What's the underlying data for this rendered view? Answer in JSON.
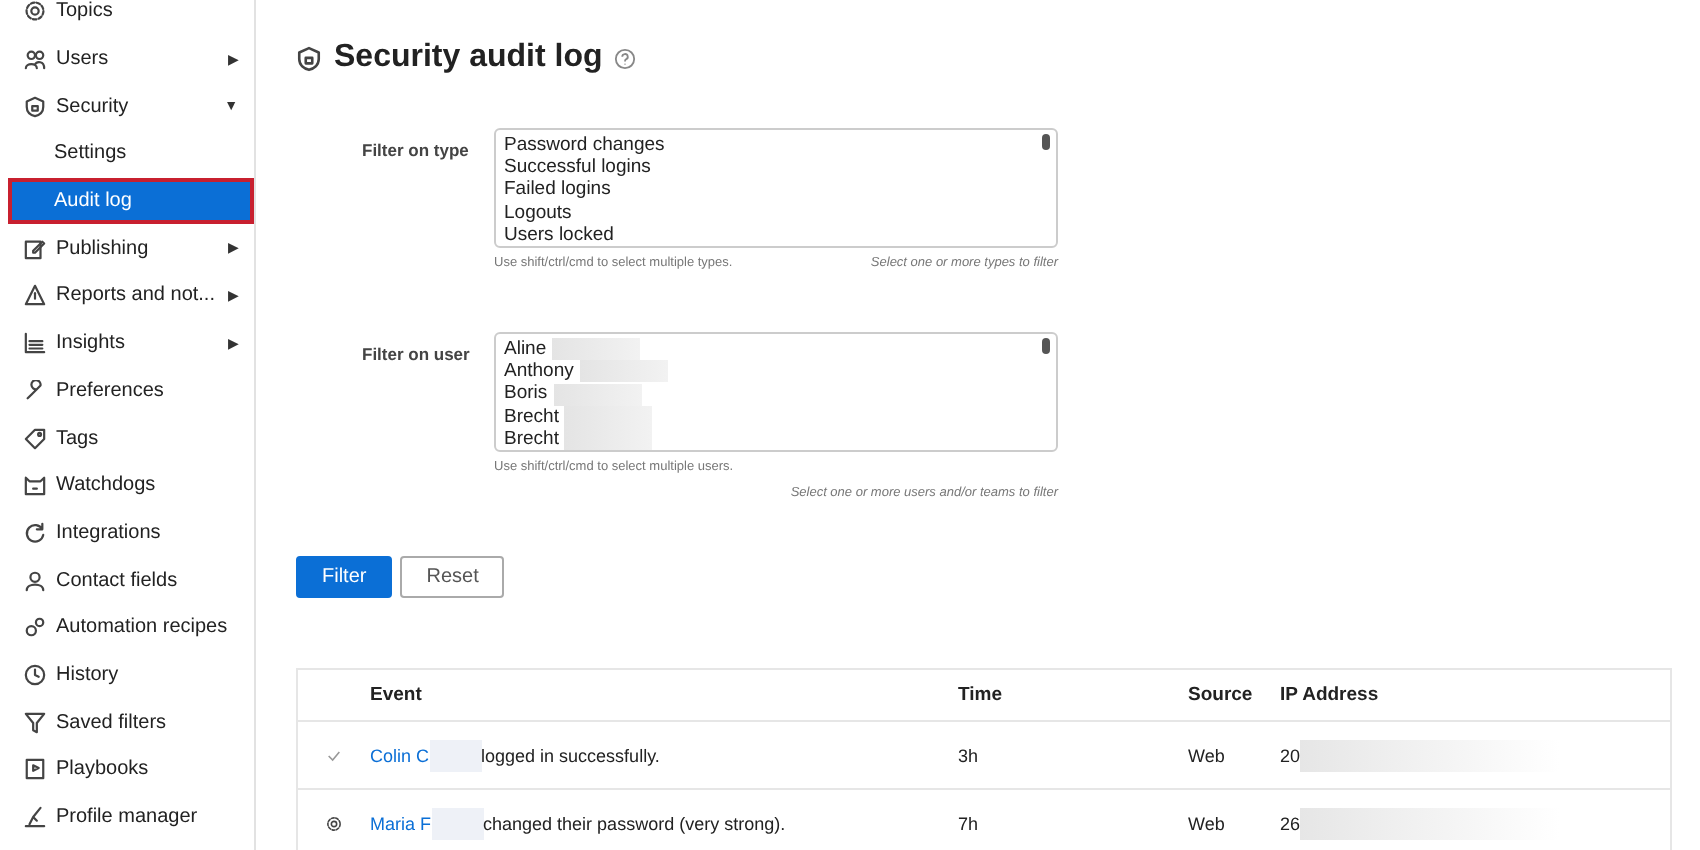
{
  "sidebar": {
    "items": [
      {
        "label": "Topics"
      },
      {
        "label": "Users",
        "arrow": "▶"
      },
      {
        "label": "Security",
        "arrow": "▼",
        "children": [
          {
            "label": "Settings",
            "selected": false
          },
          {
            "label": "Audit log",
            "selected": true
          }
        ]
      },
      {
        "label": "Publishing",
        "arrow": "▶"
      },
      {
        "label": "Reports and not...",
        "arrow": "▶"
      },
      {
        "label": "Insights",
        "arrow": "▶"
      },
      {
        "label": "Preferences"
      },
      {
        "label": "Tags"
      },
      {
        "label": "Watchdogs"
      },
      {
        "label": "Integrations"
      },
      {
        "label": "Contact fields"
      },
      {
        "label": "Automation recipes"
      },
      {
        "label": "History"
      },
      {
        "label": "Saved filters"
      },
      {
        "label": "Playbooks"
      },
      {
        "label": "Profile manager"
      }
    ]
  },
  "page": {
    "title": "Security audit log"
  },
  "filters": [
    {
      "label": "Filter on type",
      "options": [
        {
          "text": "Password changes",
          "redacted": false
        },
        {
          "text": "Successful logins",
          "redacted": false
        },
        {
          "text": "Failed logins",
          "redacted": false
        },
        {
          "text": "Logouts",
          "redacted": false
        },
        {
          "text": "Users locked",
          "redacted": false
        }
      ],
      "hint": "Use shift/ctrl/cmd to select multiple types.",
      "note": "Select one or more types to filter",
      "note_below": false
    },
    {
      "label": "Filter on user",
      "options": [
        {
          "text": "Aline",
          "redacted": true
        },
        {
          "text": "Anthony",
          "redacted": true
        },
        {
          "text": "Boris",
          "redacted": true
        },
        {
          "text": "Brecht",
          "redacted": true
        },
        {
          "text": "Brecht",
          "redacted": true
        }
      ],
      "hint": "Use shift/ctrl/cmd to select multiple users.",
      "note": "Select one or more users and/or teams to filter",
      "note_below": true
    }
  ],
  "buttons": [
    {
      "label": "Filter",
      "kind": "primary"
    },
    {
      "label": "Reset",
      "kind": "secondary"
    }
  ],
  "table": {
    "columns": [
      "Event",
      "Time",
      "Source",
      "IP Address"
    ],
    "rows": [
      {
        "kind": "check",
        "user": "Colin C",
        "message": "logged in successfully.",
        "time": "3h",
        "source": "Web",
        "ip": "20"
      },
      {
        "kind": "gear",
        "user": "Maria F",
        "message": "changed their password (very strong).",
        "time": "7h",
        "source": "Web",
        "ip": "26"
      }
    ]
  }
}
